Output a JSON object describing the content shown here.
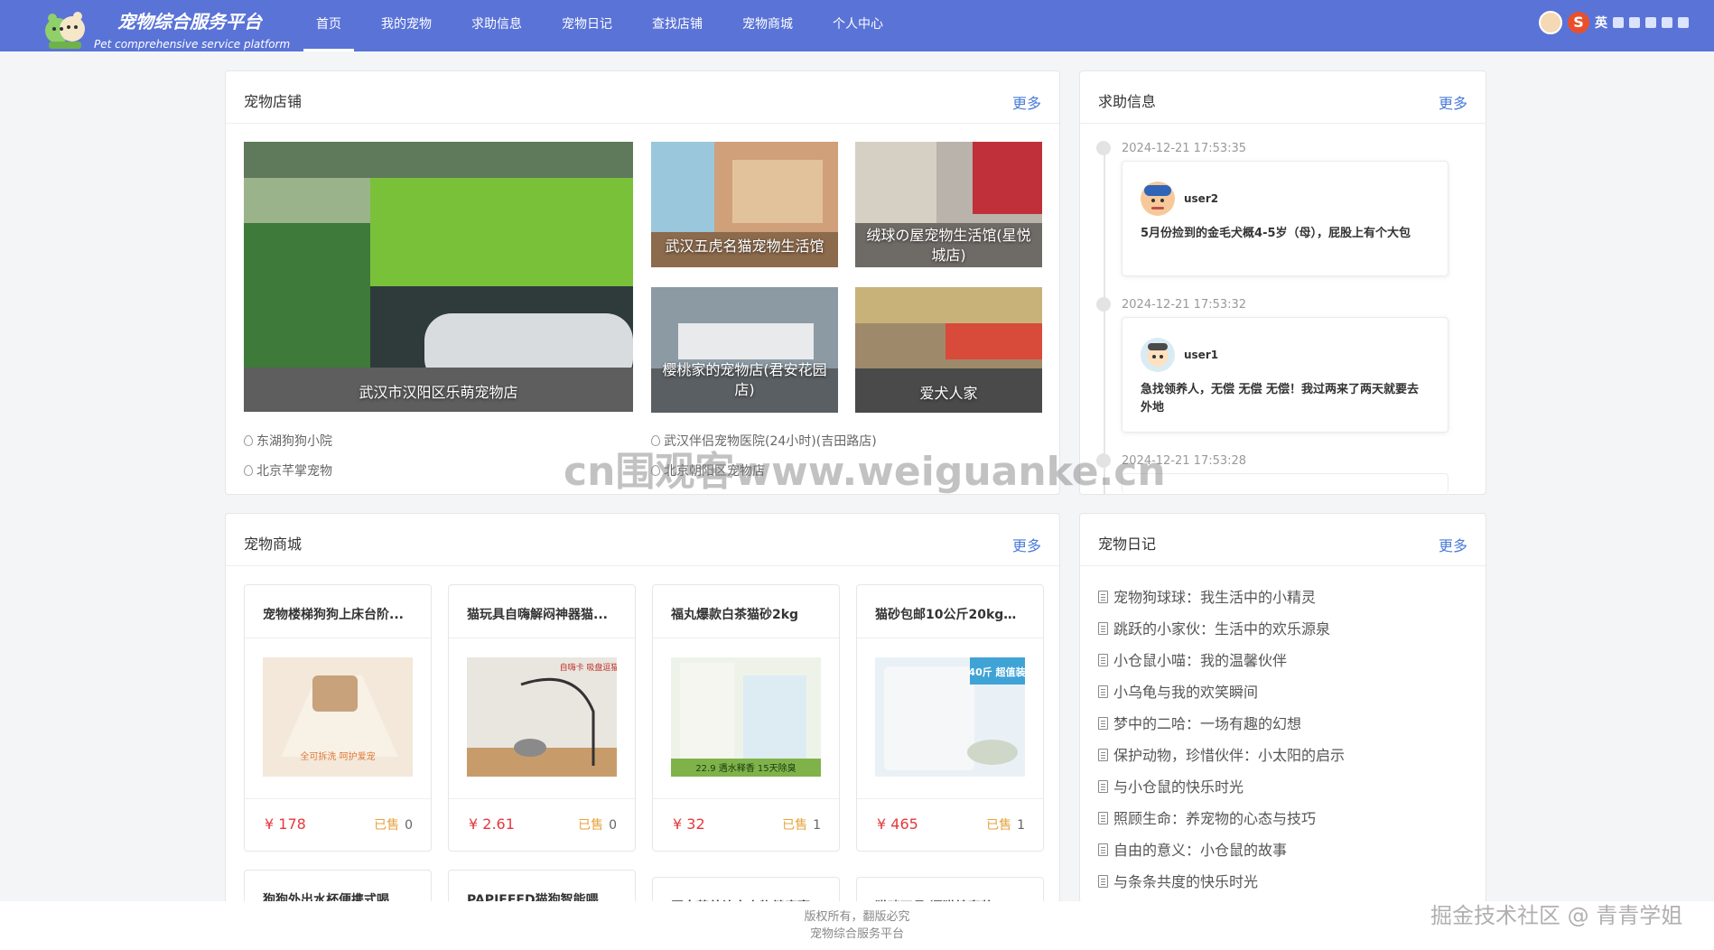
{
  "brand": {
    "title": "宠物综合服务平台",
    "subtitle": "Pet comprehensive service platform"
  },
  "nav": [
    {
      "label": "首页",
      "active": true
    },
    {
      "label": "我的宠物"
    },
    {
      "label": "求助信息"
    },
    {
      "label": "宠物日记"
    },
    {
      "label": "查找店铺"
    },
    {
      "label": "宠物商城"
    },
    {
      "label": "个人中心"
    }
  ],
  "tray": {
    "ime_s": "S",
    "ime_lang": "英"
  },
  "shops": {
    "title": "宠物店铺",
    "more": "更多",
    "tiles": [
      {
        "name": "武汉市汉阳区乐萌宠物店"
      },
      {
        "name": "武汉五虎名猫宠物生活馆"
      },
      {
        "name": "绒球の屋宠物生活馆(星悦城店)"
      },
      {
        "name": "樱桃家的宠物店(君安花园店)"
      },
      {
        "name": "爱犬人家"
      }
    ],
    "links": [
      "东湖狗狗小院",
      "武汉伴侣宠物医院(24小时)(吉田路店)",
      "北京芊掌宠物",
      "北京朝阳区宠物店"
    ]
  },
  "help": {
    "title": "求助信息",
    "more": "更多",
    "items": [
      {
        "time": "2024-12-21 17:53:35",
        "user": "user2",
        "text": "5月份捡到的金毛犬概4-5岁（母），屁股上有个大包"
      },
      {
        "time": "2024-12-21 17:53:32",
        "user": "user1",
        "text": "急找领养人，无偿 无偿 无偿！我过两来了两天就要去外地"
      },
      {
        "time": "2024-12-21 17:53:28"
      }
    ]
  },
  "mall": {
    "title": "宠物商城",
    "more": "更多",
    "sold_label": "已售",
    "items": [
      {
        "name": "宠物楼梯狗狗上床台阶...",
        "price": "¥ 178",
        "sold": "0",
        "img_text": "全可拆洗 呵护爱宠"
      },
      {
        "name": "猫玩具自嗨解闷神器猫...",
        "price": "¥ 2.61",
        "sold": "0",
        "img_text": "自嗨卡 吸盘逗猫棒"
      },
      {
        "name": "福丸爆款白茶猫砂2kg",
        "price": "¥ 32",
        "sold": "1",
        "img_text": "22.9 遇水释香 15天除臭"
      },
      {
        "name": "猫砂包邮10公斤20kg4...",
        "price": "¥ 465",
        "sold": "1",
        "img_text": "40斤 超值装"
      }
    ],
    "more_items": [
      {
        "name": "狗狗外出水杯便携式喝..."
      },
      {
        "name": "PAPIFEED猫狗智能喂..."
      },
      {
        "name": "蛋白营养补充宠物健康膏"
      },
      {
        "name": "猫咪玩具 逗猫棒套装"
      }
    ]
  },
  "diary": {
    "title": "宠物日记",
    "more": "更多",
    "items": [
      "宠物狗球球：我生活中的小精灵",
      "跳跃的小家伙：生活中的欢乐源泉",
      "小仓鼠小喵：我的温馨伙伴",
      "小乌龟与我的欢笑瞬间",
      "梦中的二哈：一场有趣的幻想",
      "保护动物，珍惜伙伴：小太阳的启示",
      "与小仓鼠的快乐时光",
      "照顾生命：养宠物的心态与技巧",
      "自由的意义：小仓鼠的故事",
      "与条条共度的快乐时光"
    ]
  },
  "footer": {
    "line1": "版权所有，翻版必究",
    "line2": "宠物综合服务平台"
  },
  "watermarks": {
    "center": "cn围观客www.weiguanke.cn",
    "corner": "掘金技术社区 @ 青青学姐"
  }
}
